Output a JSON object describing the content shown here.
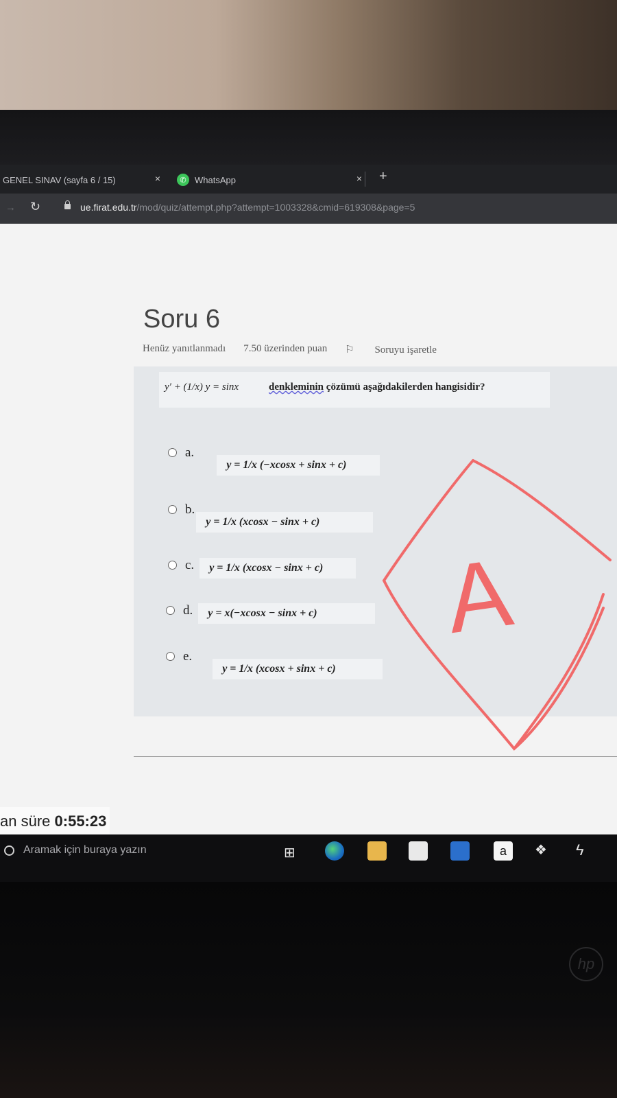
{
  "browser": {
    "tabs": [
      {
        "label": "GENEL SINAV (sayfa 6 / 15)",
        "close": "×"
      },
      {
        "label": "WhatsApp",
        "close": "×"
      }
    ],
    "new_tab": "+",
    "url_host": "ue.firat.edu.tr",
    "url_path": "/mod/quiz/attempt.php?attempt=1003328&cmid=619308&page=5"
  },
  "question": {
    "title": "Soru 6",
    "status": "Henüz yanıtlanmadı",
    "points": "7.50 üzerinden puan",
    "flag_label": "Soruyu işaretle",
    "stem_math": "y′ + (1/x) y = sinx",
    "stem_word": "denkleminin",
    "stem_rest": "çözümü aşağıdakilerden hangisidir?",
    "options": [
      {
        "letter": "a.",
        "formula": "y = 1/x (−xcosx + sinx + c)"
      },
      {
        "letter": "b.",
        "formula": "y = 1/x (xcosx − sinx + c)"
      },
      {
        "letter": "c.",
        "formula": "y = 1/x (xcosx − sinx + c)"
      },
      {
        "letter": "d.",
        "formula": "y = x(−xcosx − sinx + c)"
      },
      {
        "letter": "e.",
        "formula": "y = 1/x (xcosx + sinx + c)"
      }
    ]
  },
  "timer": {
    "label": "an süre",
    "value": "0:55:23"
  },
  "annotation": {
    "letter": "A",
    "color": "#f06a6a"
  },
  "taskbar": {
    "search_placeholder": "Aramak için buraya yazın",
    "icons": [
      "task-view-icon",
      "edge-icon",
      "file-explorer-icon",
      "store-icon",
      "mail-icon",
      "amazon-icon",
      "dropbox-icon",
      "app-icon"
    ],
    "amazon_glyph": "a"
  }
}
